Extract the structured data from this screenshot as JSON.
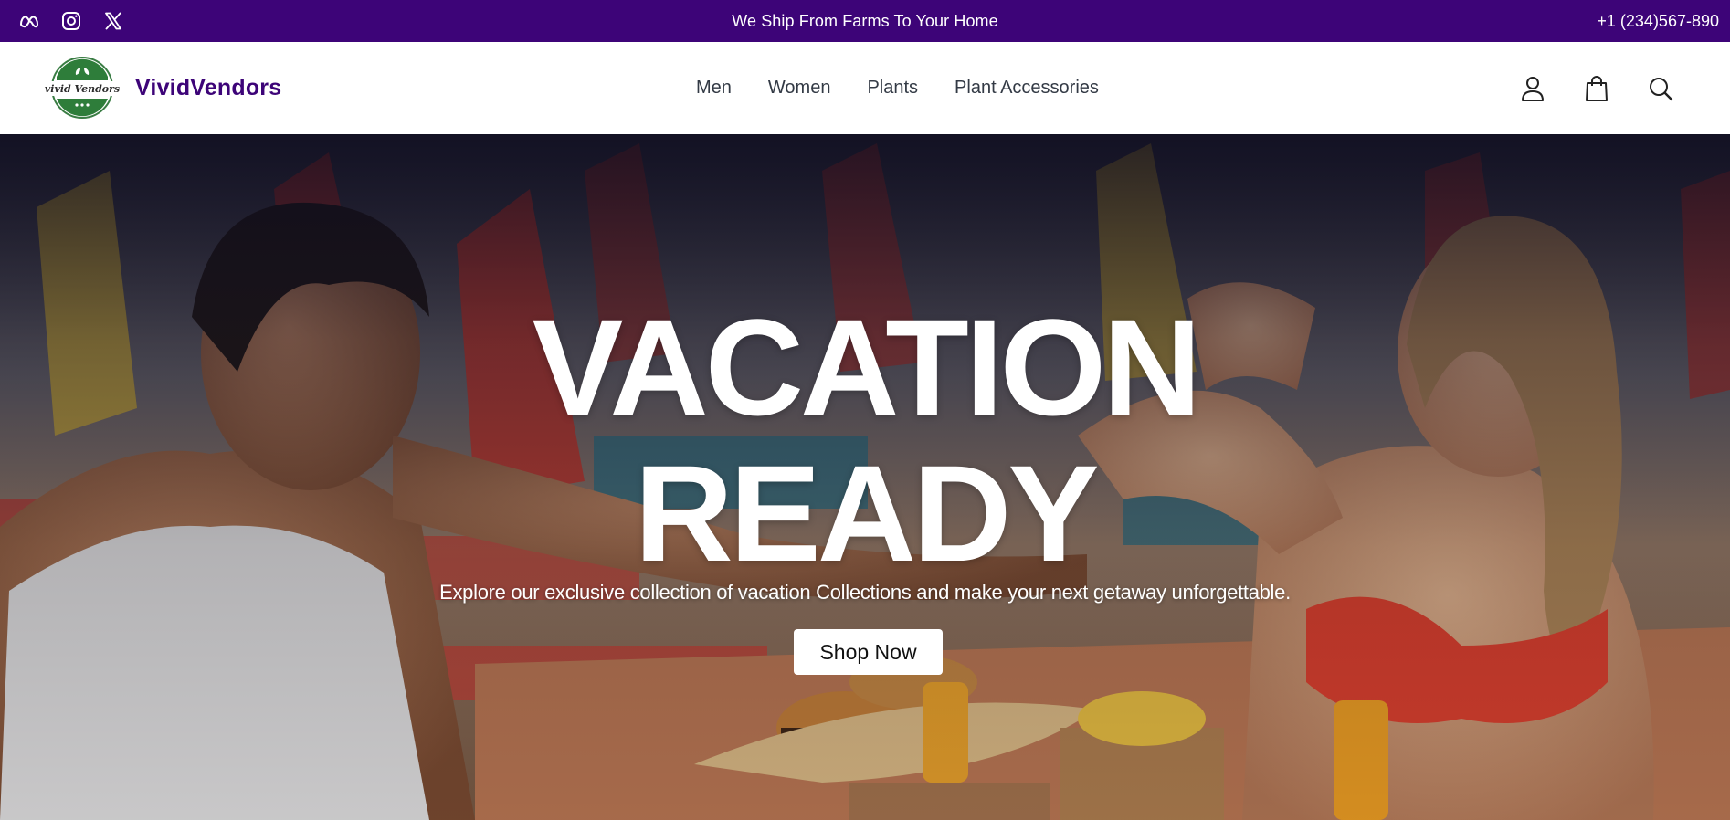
{
  "topbar": {
    "social_icons": [
      "meta-icon",
      "instagram-icon",
      "x-icon"
    ],
    "message": "We Ship From Farms To Your Home",
    "phone": "+1 (234)567-890",
    "background": "#3d0478"
  },
  "header": {
    "brand_name": "VividVendors",
    "logo_text": "vivid Vendors",
    "brand_color": "#3d0478",
    "nav": [
      {
        "label": "Men"
      },
      {
        "label": "Women"
      },
      {
        "label": "Plants"
      },
      {
        "label": "Plant Accessories"
      }
    ],
    "icons": [
      "account-icon",
      "shopping-bag-icon",
      "search-icon"
    ]
  },
  "hero": {
    "title_line1": "VACATION",
    "title_line2": "READY",
    "subtitle": "Explore our exclusive collection of vacation Collections and make your next getaway unforgettable.",
    "cta_label": "Shop Now"
  }
}
